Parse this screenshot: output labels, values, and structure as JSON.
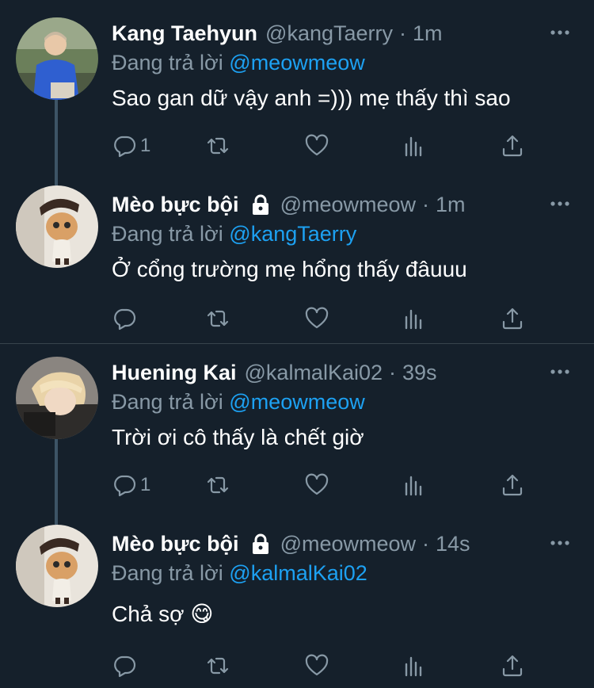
{
  "colors": {
    "background": "#15202b",
    "text": "#ffffff",
    "muted": "#8899a6",
    "link": "#1da1f2",
    "divider": "#38444d",
    "thread_line": "#3d5466"
  },
  "reply_prefix": "Đang trả lời",
  "tweets": [
    {
      "name": "Kang Taehyun",
      "locked": false,
      "handle": "@kangTaerry",
      "separator": "·",
      "time": "1m",
      "reply_to": "@meowmeow",
      "text": "Sao gan dữ vậy anh =))) mẹ thấy thì sao",
      "reply_count": "1",
      "avatar": "person-blue-sweater-avatar",
      "icons": [
        "more-icon",
        "reply-icon",
        "retweet-icon",
        "like-icon",
        "analytics-icon",
        "share-icon"
      ]
    },
    {
      "name": "Mèo bực bội",
      "locked": true,
      "handle": "@meowmeow",
      "separator": "·",
      "time": "1m",
      "reply_to": "@kangTaerry",
      "text": "Ở cổng trường mẹ hổng thấy đâuuu",
      "reply_count": "",
      "avatar": "cat-in-hat-avatar",
      "icons": [
        "lock-icon",
        "more-icon",
        "reply-icon",
        "retweet-icon",
        "like-icon",
        "analytics-icon",
        "share-icon"
      ]
    },
    {
      "name": "Huening Kai",
      "locked": false,
      "handle": "@kalmalKai02",
      "separator": "·",
      "time": "39s",
      "reply_to": "@meowmeow",
      "text": "Trời ơi cô thấy là chết giờ",
      "reply_count": "1",
      "avatar": "blond-person-avatar",
      "icons": [
        "more-icon",
        "reply-icon",
        "retweet-icon",
        "like-icon",
        "analytics-icon",
        "share-icon"
      ]
    },
    {
      "name": "Mèo bực bội",
      "locked": true,
      "handle": "@meowmeow",
      "separator": "·",
      "time": "14s",
      "reply_to": "@kalmalKai02",
      "text": "Chả sợ 😋",
      "reply_count": "",
      "avatar": "cat-in-hat-avatar",
      "icons": [
        "lock-icon",
        "more-icon",
        "reply-icon",
        "retweet-icon",
        "like-icon",
        "analytics-icon",
        "share-icon"
      ]
    }
  ]
}
